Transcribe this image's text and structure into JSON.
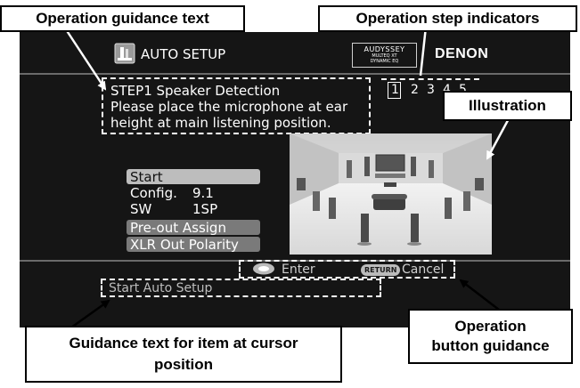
{
  "callouts": {
    "guidance_text": "Operation guidance text",
    "step_indicators": "Operation step indicators",
    "illustration": "Illustration",
    "operation_button_guidance_line1": "Operation",
    "operation_button_guidance_line2": "button guidance",
    "cursor_guidance_line1": "Guidance text for item at cursor",
    "cursor_guidance_line2": "position"
  },
  "header": {
    "title": "AUTO SETUP",
    "audyssey_line1": "AUDYSSEY",
    "audyssey_line2": "MULTEQ XT",
    "audyssey_line3": "DYNAMIC EQ",
    "brand": "DENON"
  },
  "steps": {
    "current": "1",
    "others": [
      "2",
      "3",
      "4",
      "5"
    ]
  },
  "guidance": {
    "line1": "STEP1 Speaker Detection",
    "line2": "Please place the microphone at ear",
    "line3": "height at main listening position."
  },
  "menu": {
    "start": "Start",
    "config_label": "Config.",
    "config_value": "9.1",
    "sw_label": "SW",
    "sw_value": "1SP",
    "preout": "Pre-out Assign",
    "xlr": "XLR Out Polarity"
  },
  "footer": {
    "enter_label": "Enter",
    "return_pill": "RETURN",
    "cancel_label": "Cancel",
    "cursor_text": "Start Auto Setup"
  },
  "colors": {
    "screen_bg": "#151515",
    "menu_highlight": "#bdbdbd",
    "text": "#ffffff"
  },
  "icons": [
    "auto-setup-icon",
    "enter-button-icon",
    "return-button-icon",
    "speaker-room-illustration"
  ]
}
